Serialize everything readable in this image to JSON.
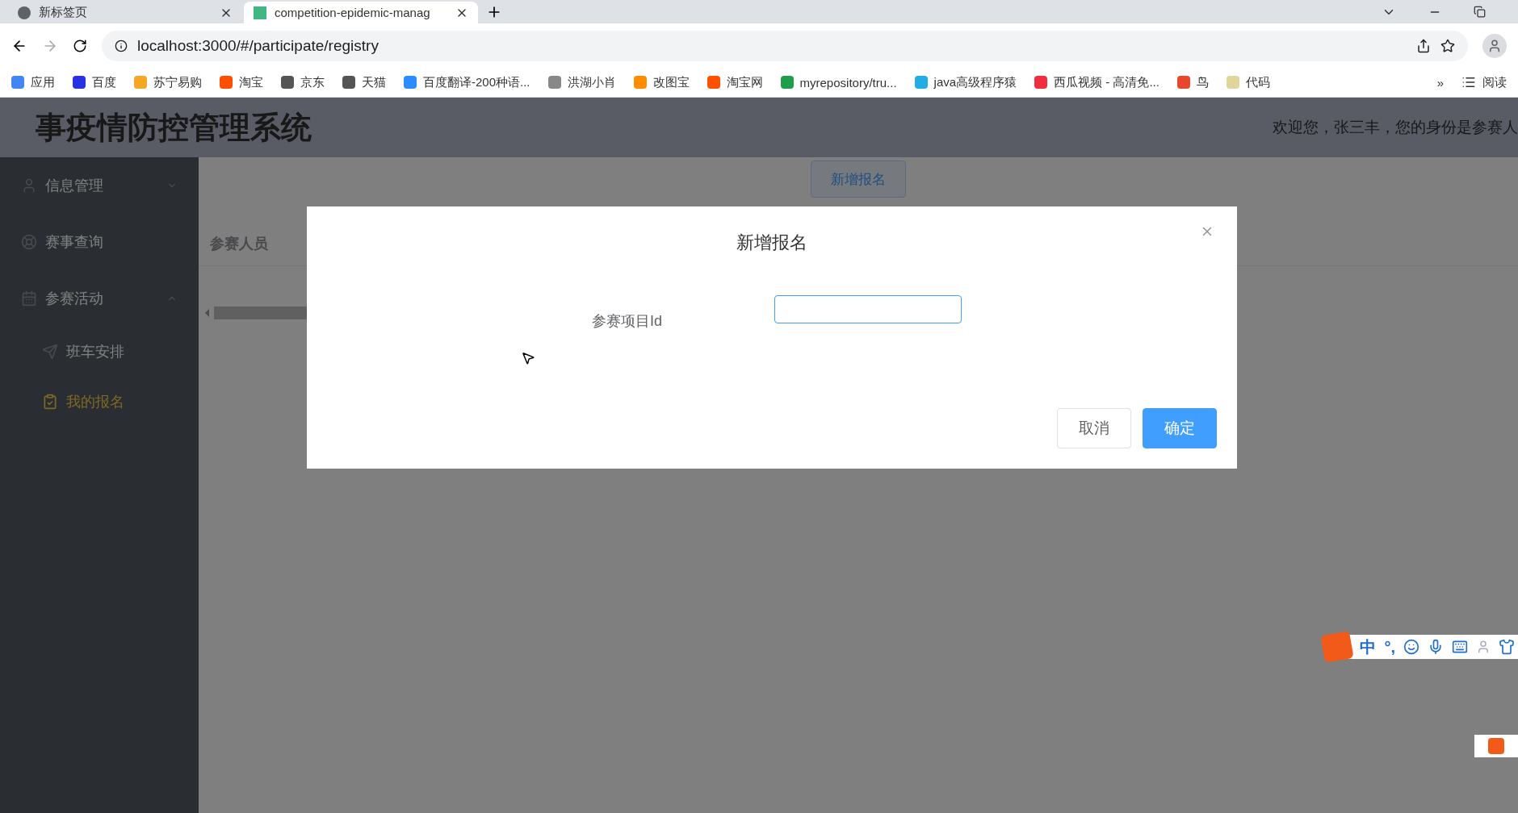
{
  "browser": {
    "tabs": [
      {
        "title": "新标签页",
        "selected": false
      },
      {
        "title": "competition-epidemic-manag",
        "selected": true
      }
    ],
    "address": "localhost:3000/#/participate/registry",
    "bookmarks": [
      {
        "label": "应用",
        "color": "#4285f4"
      },
      {
        "label": "百度",
        "color": "#2932e1"
      },
      {
        "label": "苏宁易购",
        "color": "#f5a623"
      },
      {
        "label": "淘宝",
        "color": "#ff5000"
      },
      {
        "label": "京东",
        "color": "#555555"
      },
      {
        "label": "天猫",
        "color": "#555555"
      },
      {
        "label": "百度翻译-200种语...",
        "color": "#2a8cff"
      },
      {
        "label": "洪湖小肖",
        "color": "#888888"
      },
      {
        "label": "改图宝",
        "color": "#ff8c00"
      },
      {
        "label": "淘宝网",
        "color": "#ff5000"
      },
      {
        "label": "myrepository/tru...",
        "color": "#1e9e4a"
      },
      {
        "label": "java高级程序猿",
        "color": "#23ade5"
      },
      {
        "label": "西瓜视频 - 高清免...",
        "color": "#f02e3e"
      },
      {
        "label": "鸟",
        "color": "#e8472b"
      },
      {
        "label": "代码",
        "color": "#e0d59a"
      }
    ],
    "more": "»",
    "reading_list": "阅读"
  },
  "app": {
    "title": "事疫情防控管理系统",
    "welcome": "欢迎您，张三丰，您的身份是参赛人",
    "sidebar": [
      {
        "label": "信息管理",
        "expanded": false,
        "selected": false
      },
      {
        "label": "赛事查询",
        "selected": false
      },
      {
        "label": "参赛活动",
        "expanded": true,
        "selected": false,
        "children": [
          {
            "label": "班车安排",
            "selected": false
          },
          {
            "label": "我的报名",
            "selected": true
          }
        ]
      }
    ],
    "add_button": "新增报名",
    "table": {
      "columns": [
        "参赛人员"
      ]
    }
  },
  "dialog": {
    "title": "新增报名",
    "fields": [
      {
        "label": "参赛项目Id"
      }
    ],
    "buttons": [
      {
        "label": "取消",
        "kind": "default"
      },
      {
        "label": "确定",
        "kind": "primary"
      }
    ]
  },
  "ime": {
    "mode": "中",
    "punct": "°,"
  }
}
